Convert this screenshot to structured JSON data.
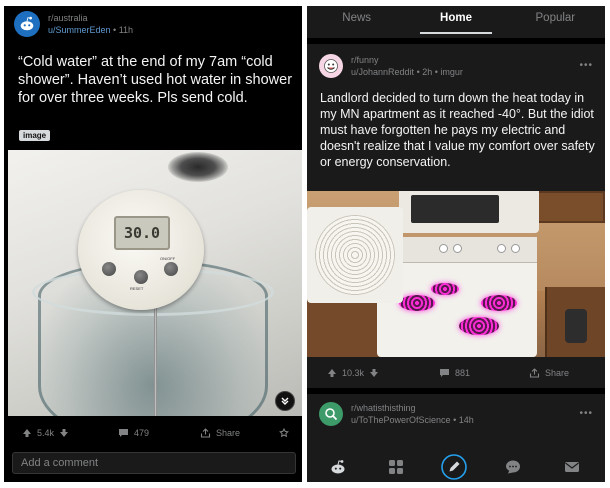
{
  "left_post": {
    "subreddit": "r/australia",
    "user": "u/SummerEden",
    "age": "11h",
    "title": "“Cold water” at the end of my 7am “cold shower”. Haven’t used hot water in shower for over three weeks. Pls send cold.",
    "flair": "image",
    "thermometer_reading": "30.0",
    "thermometer_buttons": [
      "RESET",
      "ON/OFF"
    ],
    "upvotes": "5.4k",
    "comments": "479",
    "share_label": "Share",
    "comment_placeholder": "Add a comment"
  },
  "right_app": {
    "tabs": [
      {
        "label": "News",
        "active": false
      },
      {
        "label": "Home",
        "active": true
      },
      {
        "label": "Popular",
        "active": false
      }
    ],
    "post1": {
      "subreddit": "r/funny",
      "user": "u/JohannReddit",
      "age": "2h",
      "source": "imgur",
      "title": "Landlord decided to turn down the heat today in my MN apartment as it reached -40°. But the idiot must have forgotten he pays my electric and doesn't realize that I value my comfort over safety or energy conservation.",
      "upvotes": "10.3k",
      "comments": "881",
      "share_label": "Share"
    },
    "post2": {
      "subreddit": "r/whatisthisthing",
      "user": "u/ToThePowerOfScience",
      "age": "14h"
    },
    "bottom_nav": [
      "reddit-home-icon",
      "communities-icon",
      "create-post-icon",
      "chat-icon",
      "inbox-icon"
    ]
  },
  "colors": {
    "background": "#000000",
    "card": "#1a1a1b",
    "text": "#d7dadc",
    "muted": "#818384",
    "link_blue": "#5f99cf",
    "coil_glow": "#ff2bd6"
  }
}
